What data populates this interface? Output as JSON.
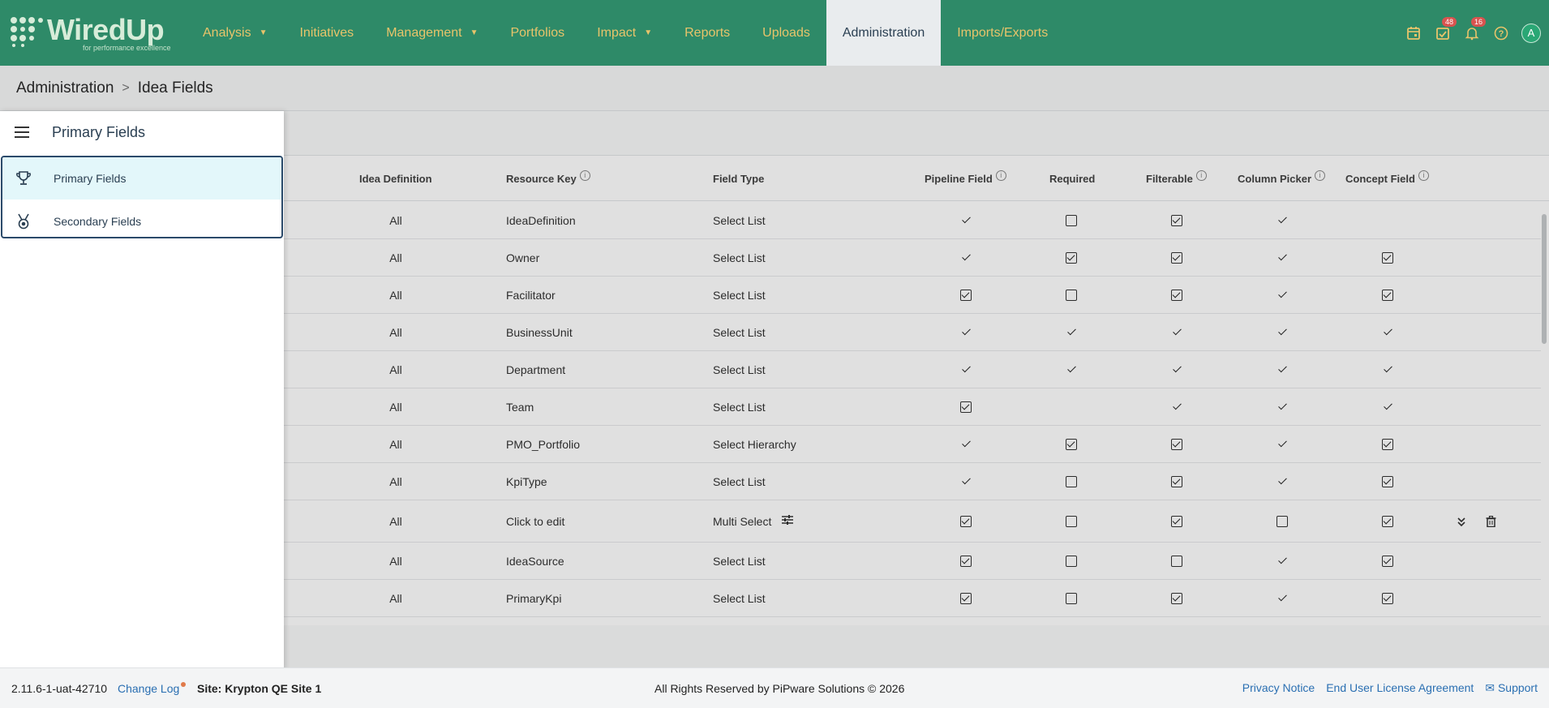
{
  "app": {
    "logo_text": "WiredUp",
    "logo_tagline": "for performance excellence"
  },
  "nav": {
    "items": [
      {
        "label": "Analysis",
        "dropdown": true
      },
      {
        "label": "Initiatives",
        "dropdown": false
      },
      {
        "label": "Management",
        "dropdown": true
      },
      {
        "label": "Portfolios",
        "dropdown": false
      },
      {
        "label": "Impact",
        "dropdown": true
      },
      {
        "label": "Reports",
        "dropdown": false
      },
      {
        "label": "Uploads",
        "dropdown": false
      },
      {
        "label": "Administration",
        "dropdown": false,
        "active": true
      },
      {
        "label": "Imports/Exports",
        "dropdown": false
      }
    ],
    "right_icons": [
      {
        "icon": "calendar-icon"
      },
      {
        "icon": "task-check-icon",
        "badge": "48"
      },
      {
        "icon": "bell-icon",
        "badge": "16"
      },
      {
        "icon": "help-icon"
      }
    ],
    "avatar": "A",
    "colors": {
      "bar": "#2e8a68",
      "link": "#e8c46a",
      "active_bg": "#e9ecee"
    }
  },
  "breadcrumb": {
    "parent": "Administration",
    "current": "Idea Fields"
  },
  "table": {
    "headers": {
      "idea_definition": "Idea Definition",
      "resource_key": "Resource Key",
      "field_type": "Field Type",
      "pipeline_field": "Pipeline Field",
      "required": "Required",
      "filterable": "Filterable",
      "column_picker": "Column Picker",
      "concept_field": "Concept Field"
    },
    "rows": [
      {
        "idea_definition": "All",
        "resource_key": "IdeaDefinition",
        "field_type": "Select List",
        "pipeline": "tick",
        "required": "off",
        "filterable": "on",
        "column_picker": "tick",
        "concept": "none"
      },
      {
        "idea_definition": "All",
        "resource_key": "Owner",
        "field_type": "Select List",
        "pipeline": "tick",
        "required": "on",
        "filterable": "on",
        "column_picker": "tick",
        "concept": "on"
      },
      {
        "idea_definition": "All",
        "resource_key": "Facilitator",
        "field_type": "Select List",
        "pipeline": "on",
        "required": "off",
        "filterable": "on",
        "column_picker": "tick",
        "concept": "on"
      },
      {
        "idea_definition": "All",
        "resource_key": "BusinessUnit",
        "field_type": "Select List",
        "pipeline": "tick",
        "required": "tick",
        "filterable": "tick",
        "column_picker": "tick",
        "concept": "tick"
      },
      {
        "idea_definition": "All",
        "resource_key": "Department",
        "field_type": "Select List",
        "pipeline": "tick",
        "required": "tick",
        "filterable": "tick",
        "column_picker": "tick",
        "concept": "tick"
      },
      {
        "idea_definition": "All",
        "resource_key": "Team",
        "field_type": "Select List",
        "pipeline": "on",
        "required": "none",
        "filterable": "tick",
        "column_picker": "tick",
        "concept": "tick"
      },
      {
        "idea_definition": "All",
        "resource_key": "PMO_Portfolio",
        "field_type": "Select Hierarchy",
        "pipeline": "tick",
        "required": "on",
        "filterable": "on",
        "column_picker": "tick",
        "concept": "on"
      },
      {
        "idea_definition": "All",
        "resource_key": "KpiType",
        "field_type": "Select List",
        "pipeline": "tick",
        "required": "off",
        "filterable": "on",
        "column_picker": "tick",
        "concept": "on"
      },
      {
        "idea_definition": "All",
        "resource_key": "Click to edit",
        "field_type": "Multi Select",
        "pipeline": "on",
        "required": "off",
        "filterable": "on",
        "column_picker": "off",
        "concept": "on",
        "editable": true
      },
      {
        "idea_definition": "All",
        "resource_key": "IdeaSource",
        "field_type": "Select List",
        "pipeline": "on",
        "required": "off",
        "filterable": "off",
        "column_picker": "tick",
        "concept": "on"
      },
      {
        "idea_definition": "All",
        "resource_key": "PrimaryKpi",
        "field_type": "Select List",
        "pipeline": "on",
        "required": "off",
        "filterable": "on",
        "column_picker": "tick",
        "concept": "on"
      }
    ]
  },
  "drawer": {
    "title": "Primary Fields",
    "items": [
      {
        "label": "Primary Fields",
        "icon": "trophy-icon",
        "selected": true
      },
      {
        "label": "Secondary Fields",
        "icon": "medal-icon",
        "selected": false
      }
    ]
  },
  "footer": {
    "version": "2.11.6-1-uat-42710",
    "change_log": "Change Log",
    "site": "Site: Krypton QE Site 1",
    "copyright": "All Rights Reserved by PiPware Solutions © 2026",
    "privacy": "Privacy Notice",
    "eula": "End User License Agreement",
    "support": "Support"
  }
}
